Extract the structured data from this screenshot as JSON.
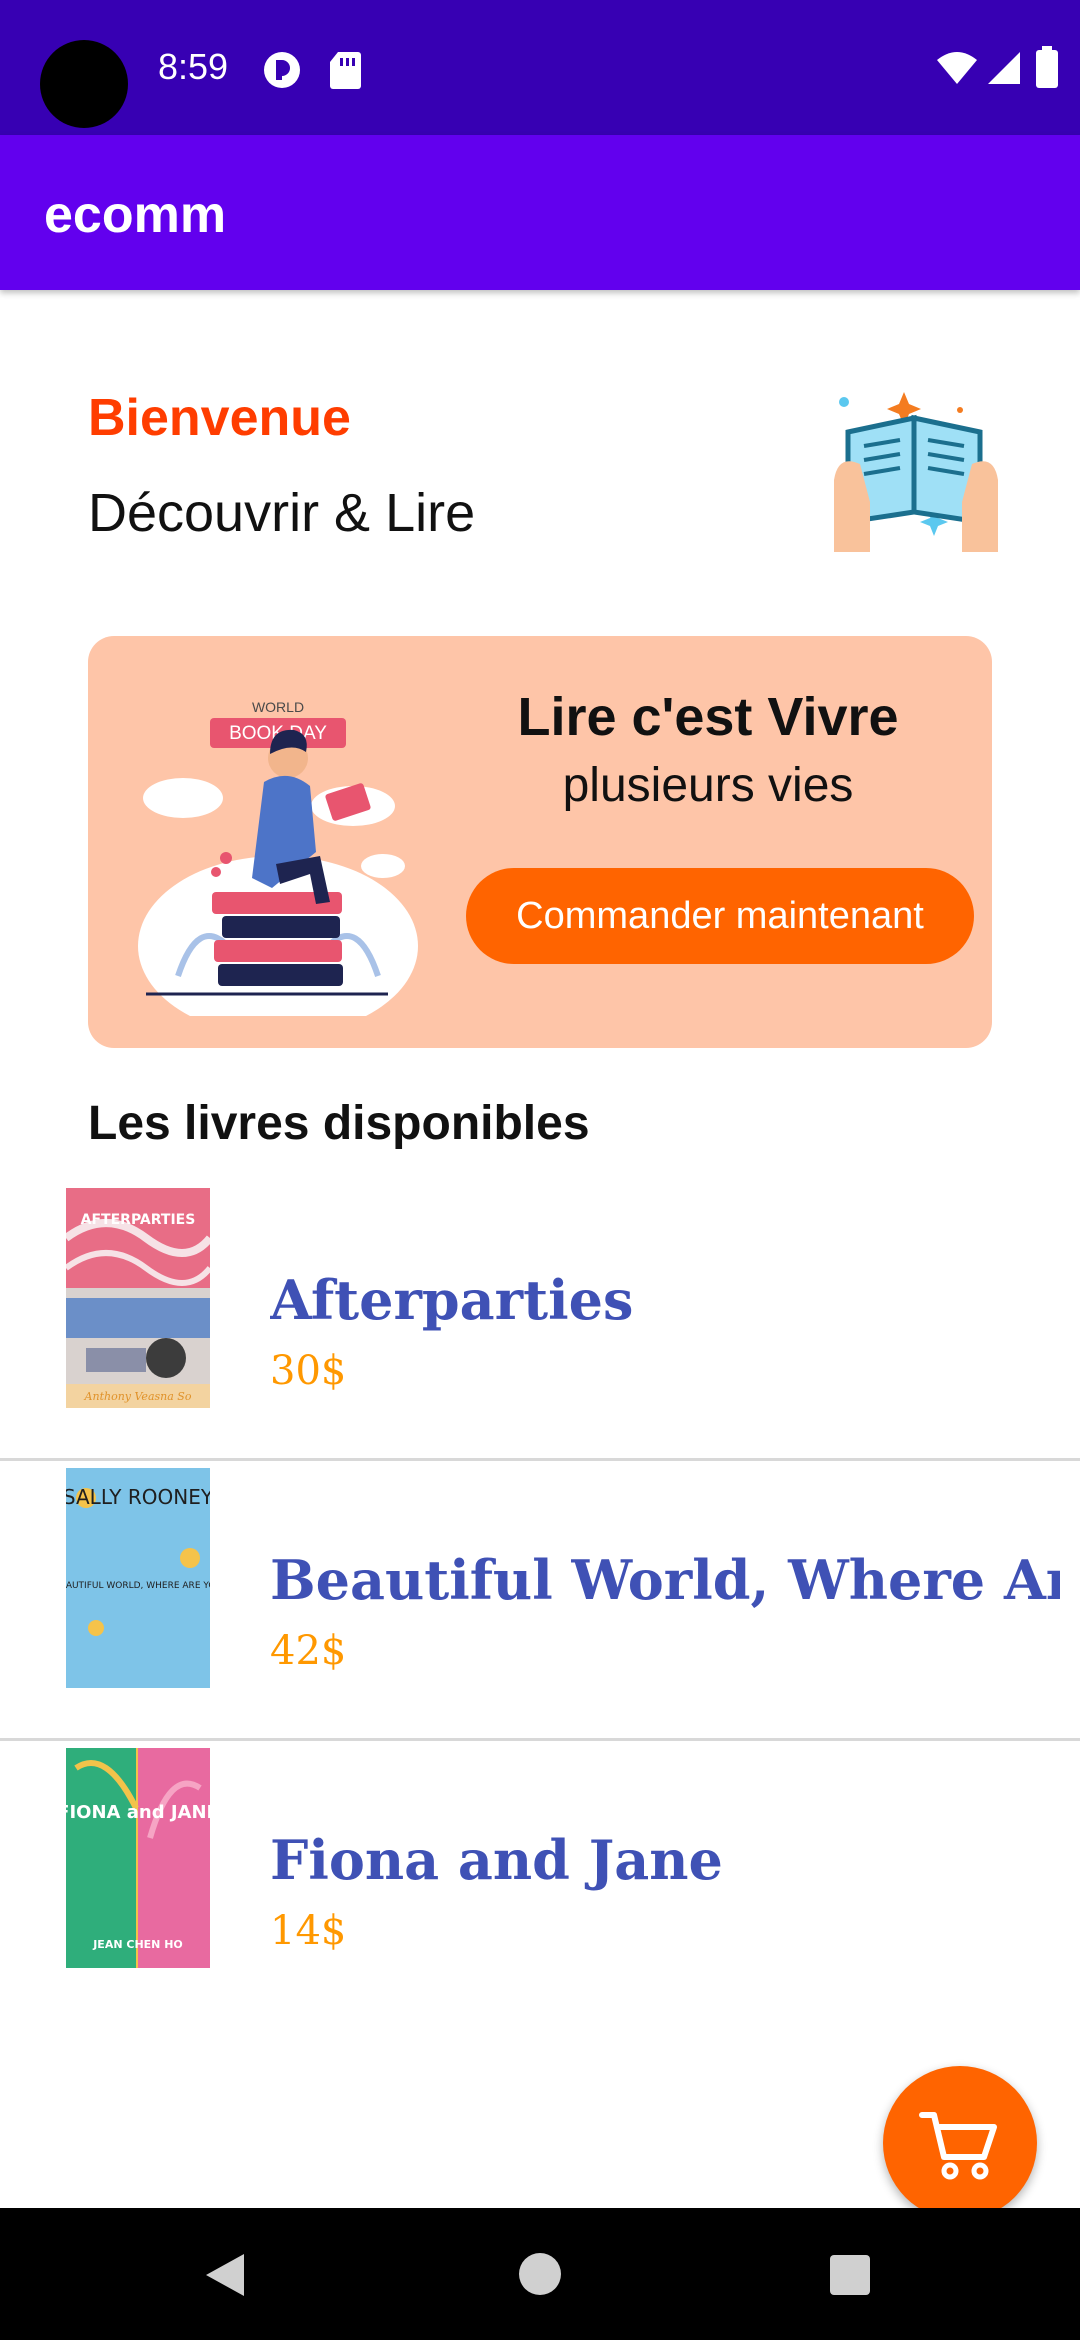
{
  "status_bar": {
    "time": "8:59"
  },
  "app_bar": {
    "title": "ecomm"
  },
  "welcome": {
    "title": "Bienvenue",
    "subtitle": "Découvrir & Lire"
  },
  "banner": {
    "badge_line1": "WORLD",
    "badge_line2": "BOOK DAY",
    "title": "Lire c'est Vivre",
    "subtitle": "plusieurs vies",
    "button_label": "Commander maintenant"
  },
  "section": {
    "title": "Les livres disponibles"
  },
  "books": [
    {
      "title": "Afterparties",
      "price": "30$",
      "cover_text": "AFTERPARTIES",
      "cover_author": "Anthony Veasna So"
    },
    {
      "title": "Beautiful World, Where Are You",
      "price": "42$",
      "cover_text": "SALLY ROONEY",
      "cover_author": "BEAUTIFUL WORLD, WHERE ARE YOU"
    },
    {
      "title": "Fiona and Jane",
      "price": "14$",
      "cover_text": "FIONA and JANE",
      "cover_author": "JEAN CHEN HO"
    }
  ],
  "colors": {
    "status_bar": "#3700b3",
    "app_bar": "#6200ee",
    "accent": "#ff6400",
    "welcome_title": "#ff3d00",
    "banner_bg": "#fec5a8",
    "book_title": "#3f51b5",
    "book_price": "#ff9800"
  },
  "icons": [
    "camera-cutout",
    "data-saver-icon",
    "sd-card-icon",
    "wifi-icon",
    "signal-icon",
    "battery-icon",
    "cart-icon",
    "back-icon",
    "home-icon",
    "recents-icon"
  ]
}
